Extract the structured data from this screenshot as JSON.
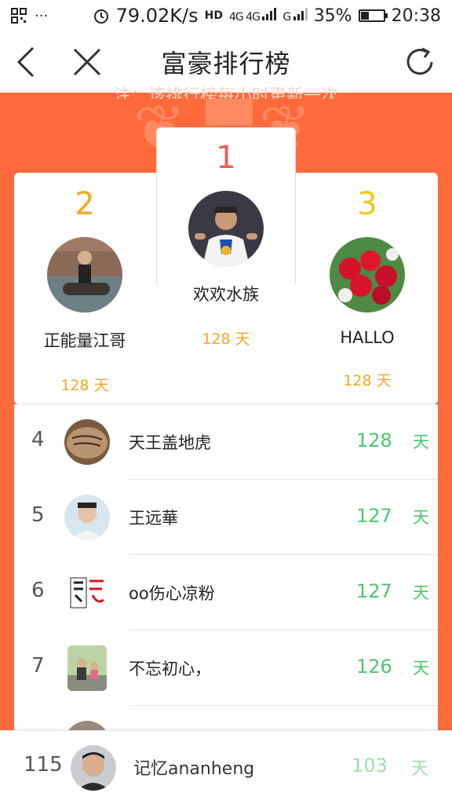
{
  "status_bar": {
    "network_speed": "79.02K/s",
    "hd": "HD",
    "signal1": "4G 4G",
    "signal2": "G",
    "battery_percent_text": "35%",
    "battery_level": 0.35,
    "time": "20:38",
    "left_icons": [
      "qr-icon",
      "more-dots-icon"
    ],
    "more_text": "···"
  },
  "nav": {
    "title": "富豪排行榜",
    "back_icon": "back-arrow-icon",
    "close_icon": "close-icon",
    "refresh_icon": "refresh-icon"
  },
  "banner": {
    "text": "注：该排行榜每小时更新一次"
  },
  "podium": {
    "first": {
      "rank": "1",
      "name": "欢欢水族",
      "days": "128 天",
      "rank_color": "#ef5a5a"
    },
    "second": {
      "rank": "2",
      "name": "正能量江哥",
      "days": "128 天",
      "rank_color": "#f5a623"
    },
    "third": {
      "rank": "3",
      "name": "HALLO",
      "days": "128 天",
      "rank_color": "#f5c518"
    }
  },
  "list": [
    {
      "rank": "4",
      "name": "天王盖地虎",
      "days": "128",
      "unit": "天"
    },
    {
      "rank": "5",
      "name": "王远華",
      "days": "127",
      "unit": "天"
    },
    {
      "rank": "6",
      "name": "oo伤心凉粉",
      "days": "127",
      "unit": "天"
    },
    {
      "rank": "7",
      "name": "不忘初心，",
      "days": "126",
      "unit": "天"
    }
  ],
  "my_rank": {
    "rank": "115",
    "name": "记忆ananheng",
    "days": "103",
    "unit": "天"
  },
  "colors": {
    "orange": "#ff6a3d",
    "green": "#4cc76d",
    "gold": "#f5a623"
  }
}
